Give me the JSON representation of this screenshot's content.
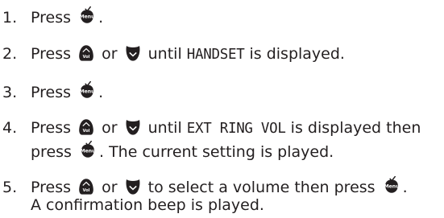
{
  "keys": {
    "menu": "Menu",
    "vol": "Vol"
  },
  "steps": [
    {
      "number": "1.",
      "parts": [
        "Press",
        "."
      ]
    },
    {
      "number": "2.",
      "parts": [
        "Press",
        "or",
        "until",
        "HANDSET",
        "is displayed."
      ]
    },
    {
      "number": "3.",
      "parts": [
        "Press",
        "."
      ]
    },
    {
      "number": "4.",
      "parts": [
        "Press",
        "or",
        "until",
        "EXT RING VOL",
        "is displayed then",
        "press",
        ". The current setting is played."
      ]
    },
    {
      "number": "5.",
      "parts": [
        "Press",
        "or",
        "to select a volume then press",
        ".",
        "A confirmation beep is played."
      ]
    }
  ],
  "colors": {
    "text": "#231f20",
    "key": "#231f20",
    "key_label": "#ffffff"
  }
}
